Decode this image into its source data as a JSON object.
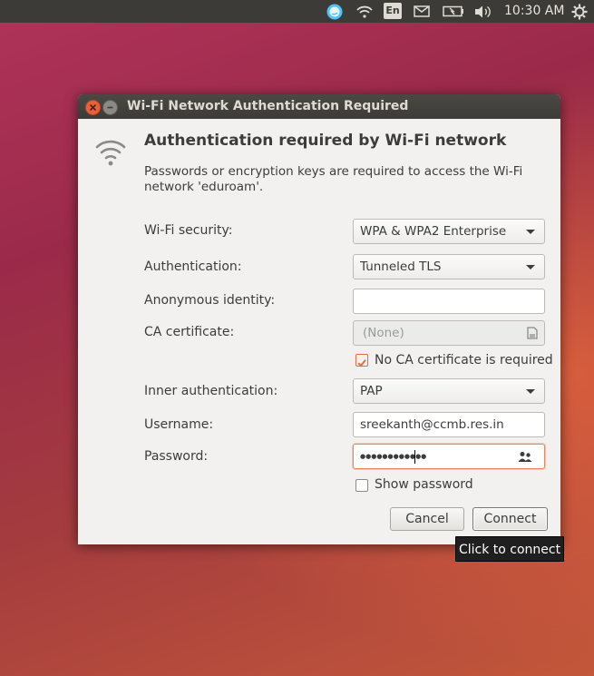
{
  "panel": {
    "language": "En",
    "clock": "10:30 AM"
  },
  "dialog": {
    "title": "Wi-Fi Network Authentication Required",
    "heading": "Authentication required by Wi-Fi network",
    "description_line1": "Passwords or encryption keys are required to access the Wi-Fi",
    "description_line2": "network 'eduroam'.",
    "fields": {
      "wifi_security": {
        "label": "Wi-Fi security:",
        "value": "WPA & WPA2 Enterprise"
      },
      "authentication": {
        "label": "Authentication:",
        "value": "Tunneled TLS"
      },
      "anonymous_identity": {
        "label": "Anonymous identity:",
        "value": ""
      },
      "ca_certificate": {
        "label": "CA certificate:",
        "value": "(None)"
      },
      "no_ca_required": {
        "label": "No CA certificate is required",
        "checked": true
      },
      "inner_authentication": {
        "label": "Inner authentication:",
        "value": "PAP"
      },
      "username": {
        "label": "Username:",
        "value": "sreekanth@ccmb.res.in"
      },
      "password": {
        "label": "Password:",
        "value": "●●●●●●●●●●●●"
      },
      "show_password": {
        "label": "Show password",
        "checked": false
      }
    },
    "buttons": {
      "cancel": "Cancel",
      "connect": "Connect"
    },
    "tooltip": "Click to connect"
  },
  "colors": {
    "panel": "#3c3b37",
    "accent": "#e07040",
    "close_button": "#e8613a"
  }
}
